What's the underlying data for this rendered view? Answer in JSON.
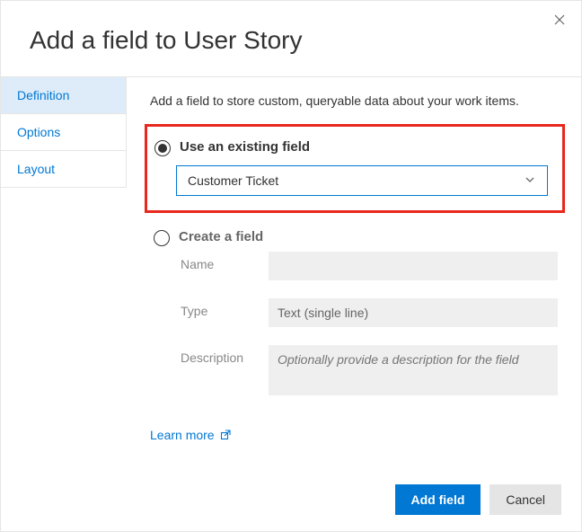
{
  "dialog": {
    "title": "Add a field to User Story"
  },
  "sidebar": {
    "items": [
      {
        "label": "Definition"
      },
      {
        "label": "Options"
      },
      {
        "label": "Layout"
      }
    ]
  },
  "main": {
    "intro": "Add a field to store custom, queryable data about your work items.",
    "useExisting": {
      "label": "Use an existing field",
      "selected": "Customer Ticket"
    },
    "createField": {
      "label": "Create a field",
      "nameLabel": "Name",
      "nameValue": "",
      "typeLabel": "Type",
      "typeValue": "Text (single line)",
      "descLabel": "Description",
      "descPlaceholder": "Optionally provide a description for the field"
    },
    "learnMore": "Learn more"
  },
  "footer": {
    "addField": "Add field",
    "cancel": "Cancel"
  }
}
